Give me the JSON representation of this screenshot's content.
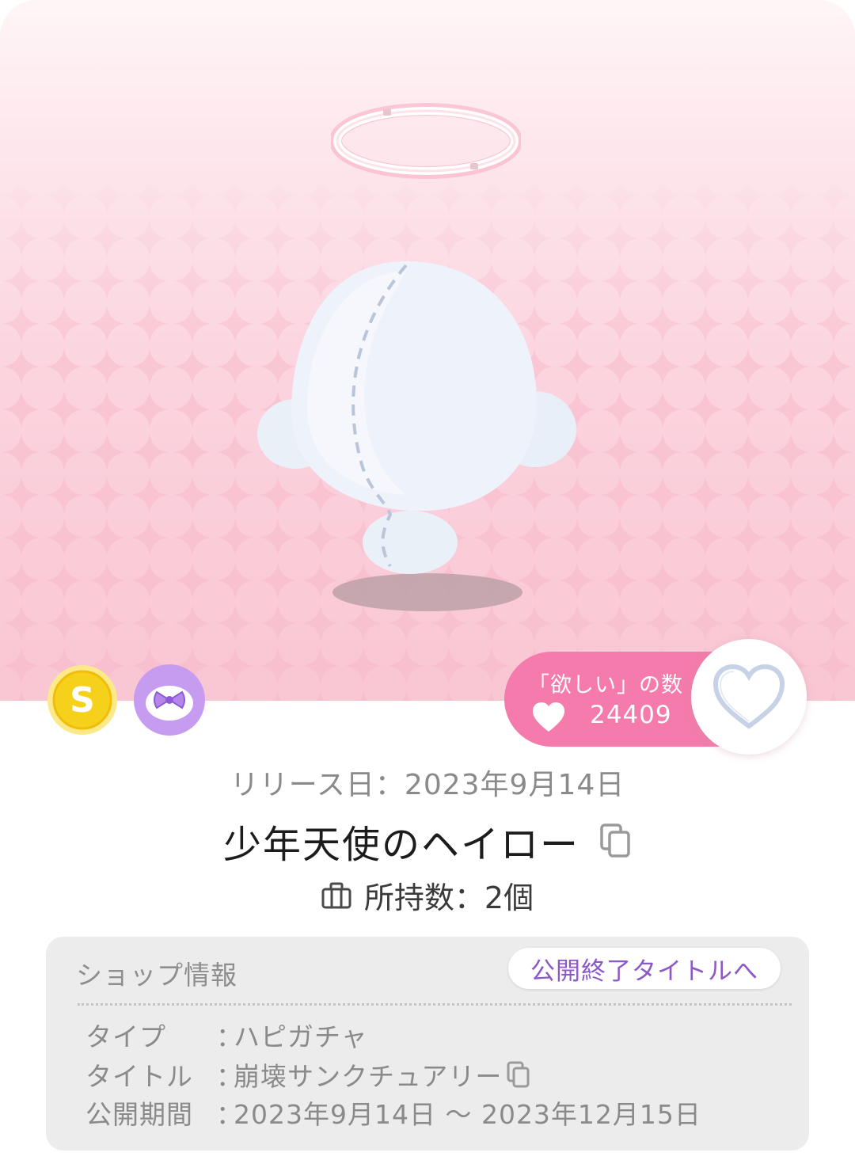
{
  "wish": {
    "label": "「欲しい」の数",
    "count": "24409"
  },
  "item": {
    "release": "リリース日：2023年9月14日",
    "name": "少年天使のヘイロー",
    "owned": "所持数：2個"
  },
  "shop": {
    "heading": "ショップ情報",
    "end_title_button": "公開終了タイトルへ",
    "rows": [
      {
        "key": "タイプ",
        "sep": "：",
        "value": "ハピガチャ"
      },
      {
        "key": "タイトル",
        "sep": "：",
        "value": "崩壊サンクチュアリー"
      },
      {
        "key": "公開期間",
        "sep": "：",
        "value": "2023年9月14日 ～ 2023年12月15日"
      }
    ]
  },
  "colors": {
    "accent_pink": "#f47bab",
    "link_purple": "#8c57c8",
    "coin_gold": "#f7d21e",
    "bow_purple": "#c59cf0"
  },
  "icons": [
    "halo-item",
    "ghost-mascot",
    "coin-s-icon",
    "bow-icon",
    "heart-icon",
    "heart-outline-icon",
    "copy-icon",
    "bag-icon"
  ]
}
